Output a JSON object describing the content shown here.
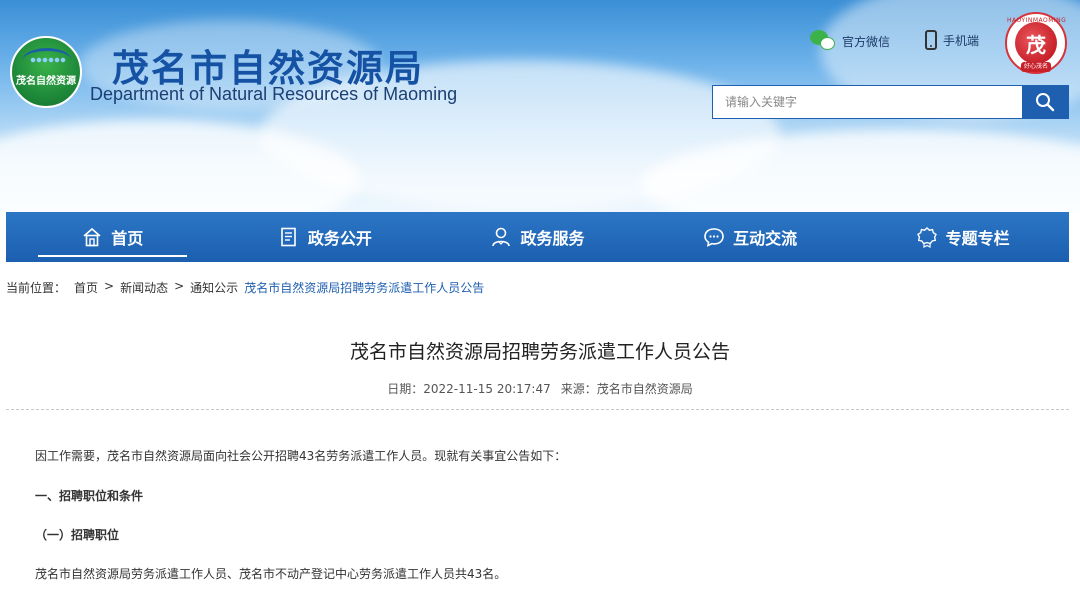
{
  "header": {
    "logo_text": "茂名自然资源",
    "title": "茂名市自然资源局",
    "subtitle": "Department of Natural Resources of Maoming",
    "wechat_label": "官方微信",
    "mobile_label": "手机端",
    "badge_ring_text": "HAOYINMAOMING",
    "badge_bottom_text": "好心茂名"
  },
  "search": {
    "placeholder": "请输入关键字",
    "icon": "search-icon"
  },
  "nav": {
    "items": [
      {
        "label": "首页",
        "icon": "home-icon"
      },
      {
        "label": "政务公开",
        "icon": "document-icon"
      },
      {
        "label": "政务服务",
        "icon": "service-person-icon"
      },
      {
        "label": "互动交流",
        "icon": "chat-bubble-icon"
      },
      {
        "label": "专题专栏",
        "icon": "badge-icon"
      }
    ],
    "active_index": 0
  },
  "breadcrumb": {
    "prefix": "当前位置：",
    "items": [
      "首页",
      "新闻动态",
      "通知公示"
    ],
    "current": "茂名市自然资源局招聘劳务派遣工作人员公告",
    "separator": ">"
  },
  "article": {
    "title": "茂名市自然资源局招聘劳务派遣工作人员公告",
    "date": "日期：2022-11-15 20:17:47",
    "source": "来源：茂名市自然资源局",
    "paragraphs": [
      "因工作需要，茂名市自然资源局面向社会公开招聘43名劳务派遣工作人员。现就有关事宜公告如下：",
      "一、招聘职位和条件",
      "（一）招聘职位",
      "茂名市自然资源局劳务派遣工作人员、茂名市不动产登记中心劳务派遣工作人员共43名。"
    ]
  },
  "colors": {
    "brand_blue": "#1f5fb0",
    "title_blue": "#1552a3",
    "logo_green": "#1e8a3a",
    "badge_red": "#c8212a"
  }
}
